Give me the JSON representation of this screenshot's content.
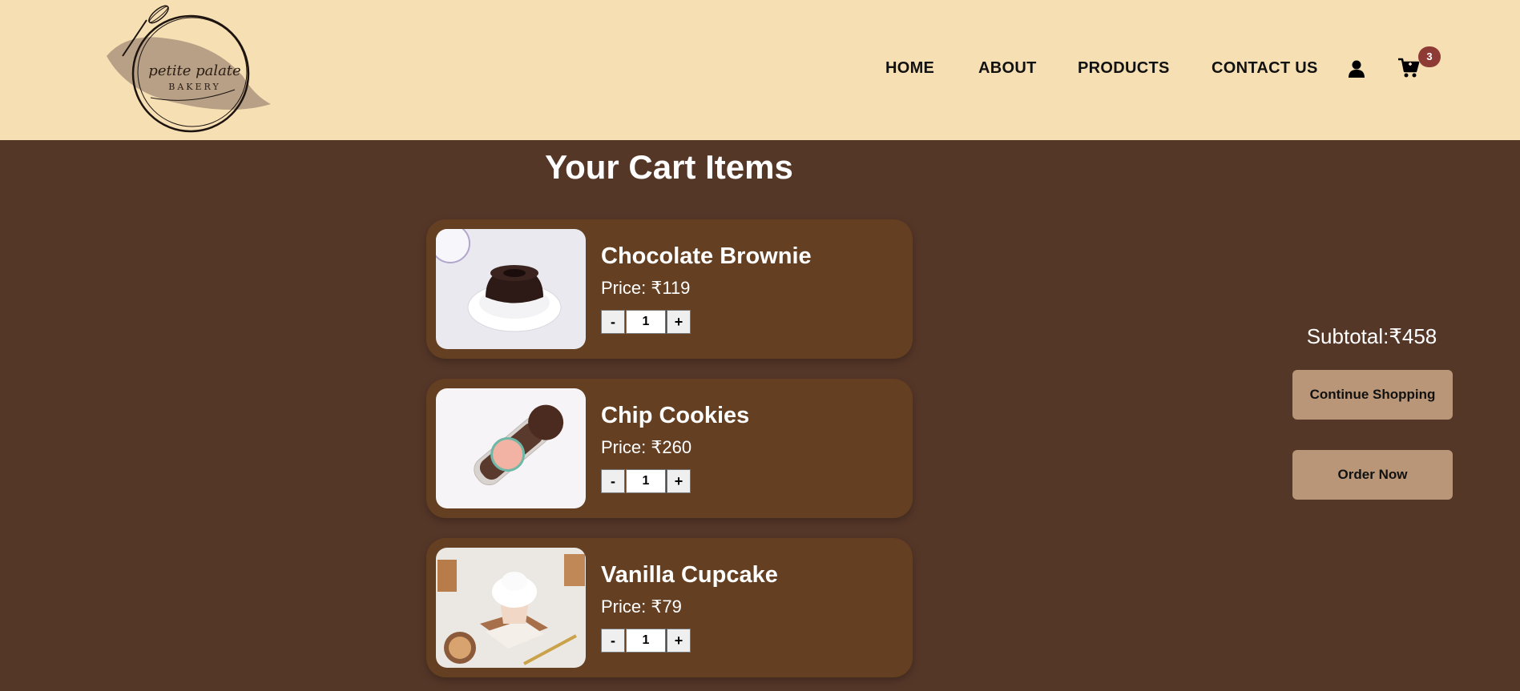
{
  "brand": {
    "name": "petite palate",
    "tagline": "BAKERY"
  },
  "nav": {
    "items": [
      "HOME",
      "ABOUT",
      "PRODUCTS",
      "CONTACT US"
    ],
    "cart_count": "3",
    "user_icon": "user-icon",
    "cart_icon": "shopping-cart-icon"
  },
  "main": {
    "title": "Your Cart Items",
    "items": [
      {
        "name": "Chocolate Brownie",
        "price": "Price: ₹119",
        "quantity": "1",
        "minus": "-",
        "plus": "+"
      },
      {
        "name": "Chip Cookies",
        "price": "Price: ₹260",
        "quantity": "1",
        "minus": "-",
        "plus": "+"
      },
      {
        "name": "Vanilla Cupcake",
        "price": "Price: ₹79",
        "quantity": "1",
        "minus": "-",
        "plus": "+"
      }
    ]
  },
  "summary": {
    "subtotal": "Subtotal:₹458",
    "continue_label": "Continue Shopping",
    "order_label": "Order Now"
  },
  "colors": {
    "header_bg": "#f6dfb3",
    "page_bg": "#553728",
    "card_bg": "#643f22",
    "button_bg": "#b99677",
    "badge_bg": "#8e3b36"
  }
}
